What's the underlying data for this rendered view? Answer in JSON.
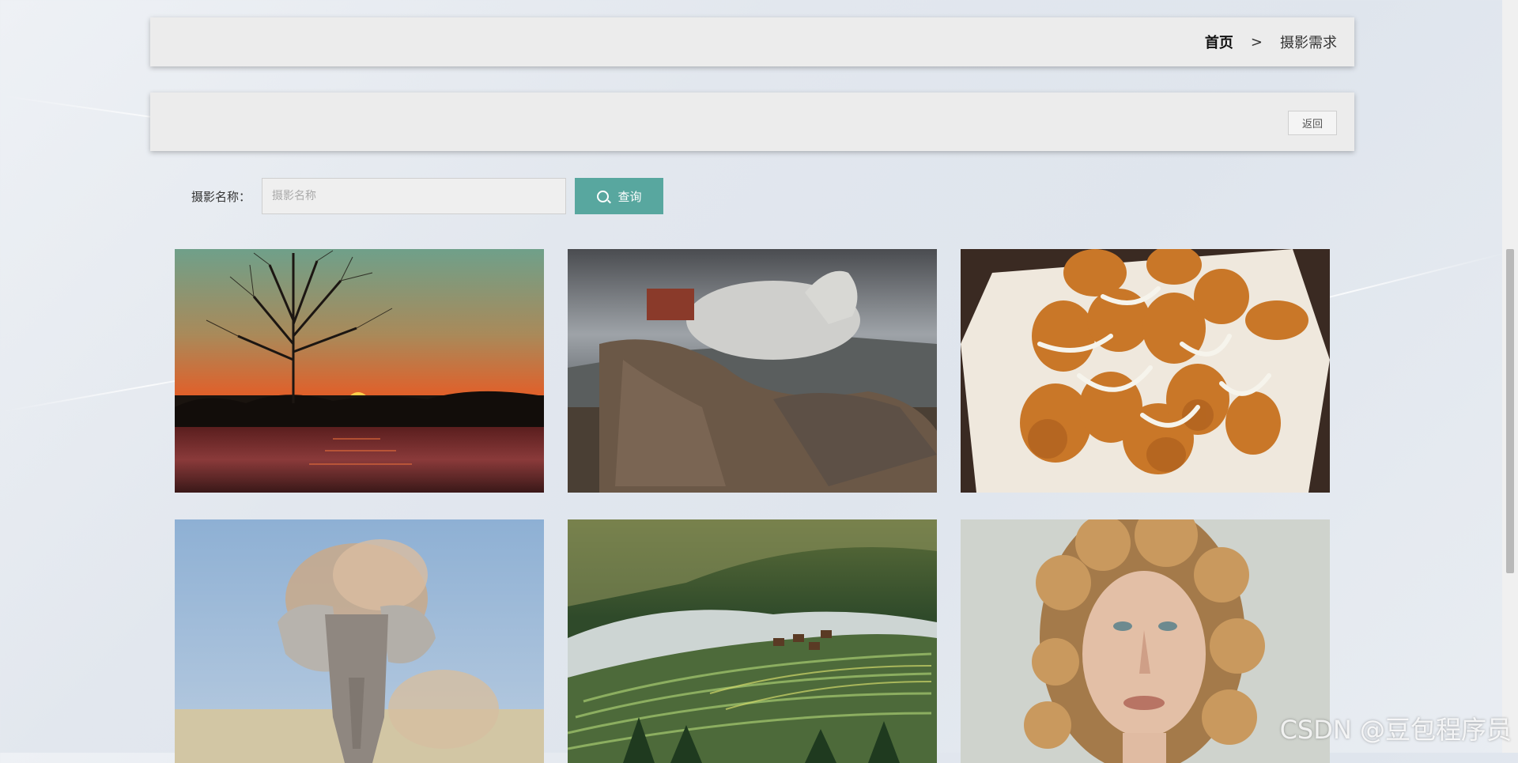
{
  "breadcrumb": {
    "home": "首页",
    "separator": ">",
    "current": "摄影需求"
  },
  "actions": {
    "back_label": "返回"
  },
  "search": {
    "label": "摄影名称：",
    "placeholder": "摄影名称",
    "value": "",
    "button_label": "查询"
  },
  "gallery": {
    "items": [
      {
        "subject": "sunset-tree-lake-photo"
      },
      {
        "subject": "horse-driftwood-photo"
      },
      {
        "subject": "roasted-potatoes-photo"
      },
      {
        "subject": "elephant-dust-photo"
      },
      {
        "subject": "rice-terraces-village-photo"
      },
      {
        "subject": "curly-hair-woman-portrait-photo"
      }
    ]
  },
  "watermark": "CSDN @豆包程序员",
  "colors": {
    "accent": "#58a79f",
    "panel": "#ececec"
  }
}
